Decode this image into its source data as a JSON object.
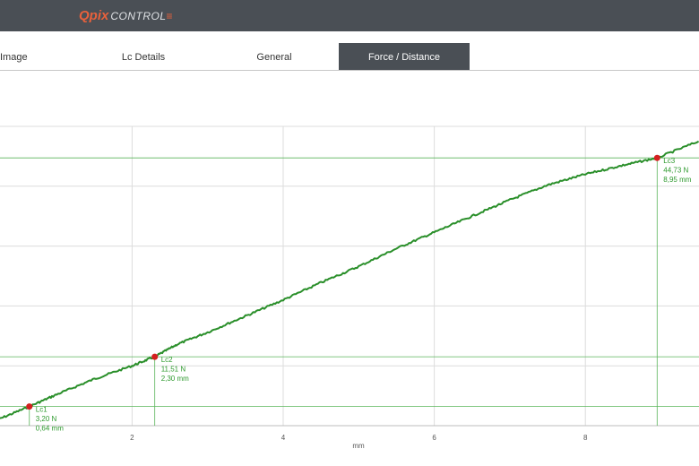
{
  "app": {
    "logo_brand": "Qpix",
    "logo_rest": "CONTROL",
    "logo_mark": "≡"
  },
  "tabs": [
    {
      "label": "Image",
      "active": false
    },
    {
      "label": "Lc Details",
      "active": false
    },
    {
      "label": "General",
      "active": false
    },
    {
      "label": "Force / Distance",
      "active": true
    }
  ],
  "colors": {
    "topbar": "#4a4f55",
    "accent": "#e8613c",
    "series": "#2a8f2a",
    "marker": "#d42020",
    "annotation": "#2e9a2e"
  },
  "chart_data": {
    "type": "line",
    "xlabel": "mm",
    "ylabel": "",
    "x_ticks": [
      "2",
      "4",
      "6",
      "8"
    ],
    "xlim": [
      0.2,
      9.5
    ],
    "ylim": [
      0,
      50
    ],
    "grid": true,
    "series": [
      {
        "x": [
          0.2,
          0.64,
          1.0,
          1.5,
          2.0,
          2.3,
          2.6,
          3.0,
          3.5,
          4.0,
          4.5,
          5.0,
          5.5,
          6.0,
          6.5,
          7.0,
          7.5,
          8.0,
          8.5,
          8.95,
          9.5
        ],
        "y": [
          0.9,
          3.2,
          5.2,
          7.8,
          10.0,
          11.51,
          13.6,
          15.6,
          18.3,
          21.0,
          23.9,
          26.6,
          29.6,
          32.3,
          35.0,
          37.7,
          40.2,
          42.0,
          43.5,
          44.73,
          47.5
        ]
      }
    ],
    "markers": [
      {
        "name": "Lc1",
        "x": 0.64,
        "y": 3.2,
        "force_label": "3,20 N",
        "dist_label": "0,64 mm"
      },
      {
        "name": "Lc2",
        "x": 2.3,
        "y": 11.51,
        "force_label": "11,51 N",
        "dist_label": "2,30 mm"
      },
      {
        "name": "Lc3",
        "x": 8.95,
        "y": 44.73,
        "force_label": "44,73 N",
        "dist_label": "8,95 mm"
      }
    ]
  }
}
